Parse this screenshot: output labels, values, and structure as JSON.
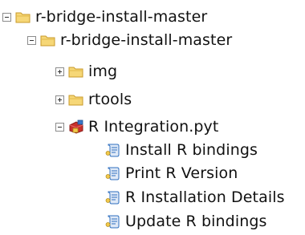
{
  "tree": {
    "root": {
      "label": "r-bridge-install-master",
      "icon": "folder-icon",
      "state": "expanded"
    },
    "child": {
      "label": "r-bridge-install-master",
      "icon": "folder-icon",
      "state": "expanded"
    },
    "folders": [
      {
        "label": "img",
        "icon": "folder-icon",
        "state": "collapsed"
      },
      {
        "label": "rtools",
        "icon": "folder-icon",
        "state": "collapsed"
      }
    ],
    "toolbox": {
      "label": "R Integration.pyt",
      "icon": "python-toolbox-icon",
      "state": "expanded"
    },
    "scripts": [
      {
        "label": "Install R bindings",
        "icon": "script-tool-icon"
      },
      {
        "label": "Print R Version",
        "icon": "script-tool-icon"
      },
      {
        "label": "R Installation Details",
        "icon": "script-tool-icon"
      },
      {
        "label": "Update R bindings",
        "icon": "script-tool-icon"
      }
    ],
    "colors": {
      "folder_fill": "#f6d777",
      "folder_edge": "#c89a2a",
      "script_blue": "#2f6fbf",
      "toolbox_red": "#c9302c"
    }
  }
}
